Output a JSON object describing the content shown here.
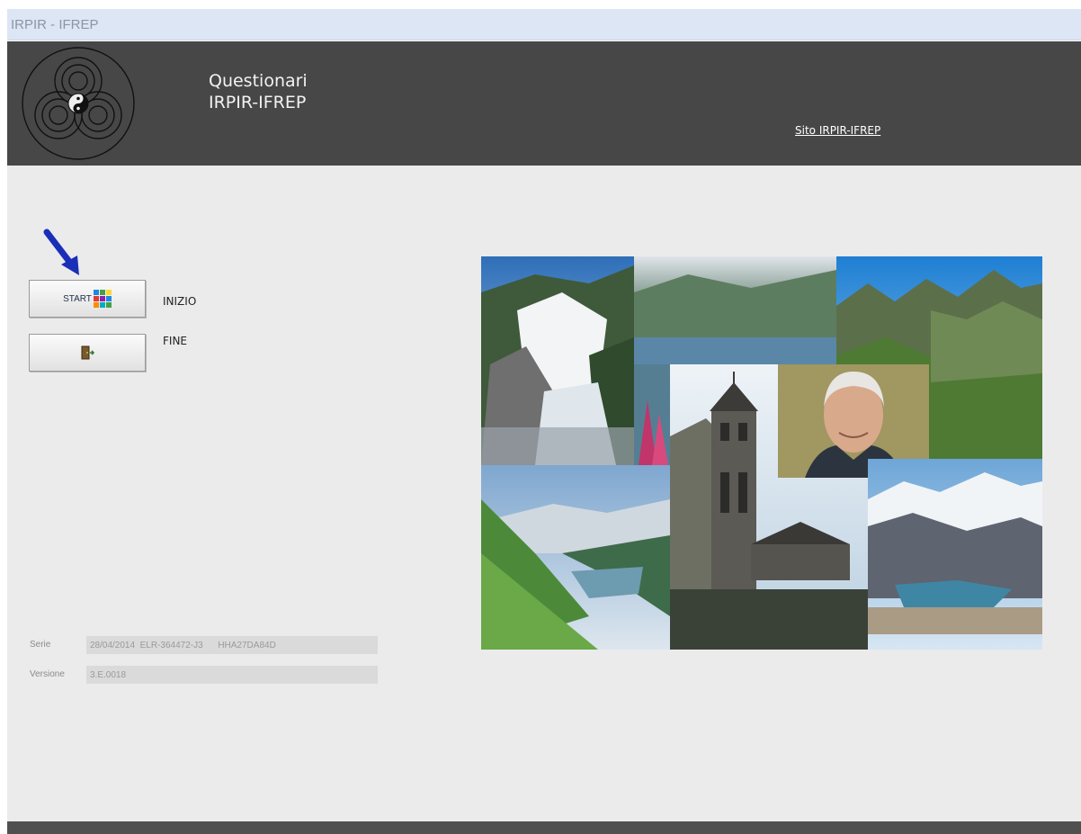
{
  "window": {
    "title": "IRPIR - IFREP"
  },
  "header": {
    "title_line1": "Questionari",
    "title_line2": "IRPIR-IFREP",
    "site_link": "Sito IRPIR-IFREP"
  },
  "actions": {
    "start_label": "START",
    "start_icon": "colorful-squares-icon",
    "start_caption": "INIZIO",
    "fine_icon": "exit-door-icon",
    "fine_caption": "FINE"
  },
  "info": {
    "serie_label": "Serie",
    "serie_value": "28/04/2014  ELR-364472-J3      HHA27DA84D",
    "versione_label": "Versione",
    "versione_value": "3.E.0018"
  },
  "colors": {
    "header_bg": "#474747",
    "body_bg": "#ebebeb",
    "titlebar_bg": "#dce6f4",
    "arrow": "#1a2fb8"
  }
}
